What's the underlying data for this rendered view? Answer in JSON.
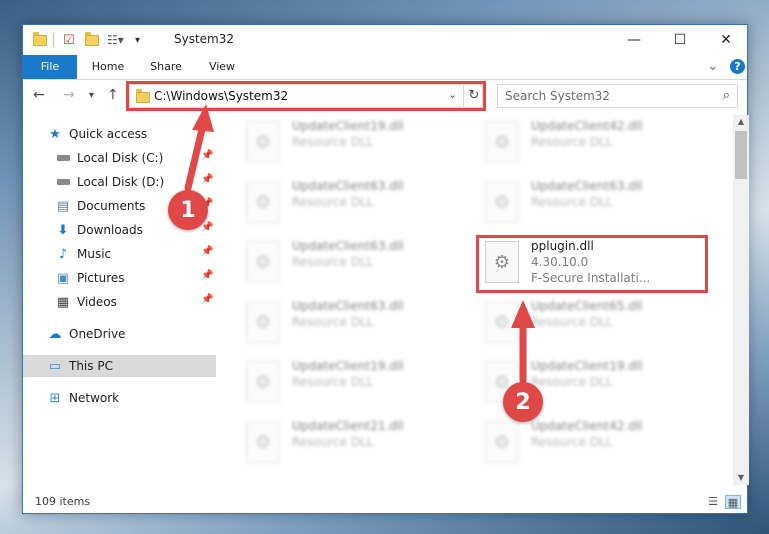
{
  "window": {
    "title": "System32",
    "controls": {
      "minimize": "—",
      "maximize": "☐",
      "close": "✕"
    }
  },
  "ribbon": {
    "tabs": [
      {
        "label": "File"
      },
      {
        "label": "Home"
      },
      {
        "label": "Share"
      },
      {
        "label": "View"
      }
    ],
    "collapse_glyph": "⌄",
    "help_glyph": "?"
  },
  "navbar": {
    "address": "C:\\Windows\\System32",
    "search_placeholder": "Search System32"
  },
  "sidebar": {
    "items": [
      {
        "label": "Quick access",
        "icon": "star-icon",
        "pinned": false,
        "selected": false
      },
      {
        "label": "Local Disk (C:)",
        "icon": "drive-icon",
        "pinned": true,
        "selected": false
      },
      {
        "label": "Local Disk (D:)",
        "icon": "drive-icon",
        "pinned": true,
        "selected": false
      },
      {
        "label": "Documents",
        "icon": "documents-icon",
        "pinned": true,
        "selected": false
      },
      {
        "label": "Downloads",
        "icon": "download-icon",
        "pinned": true,
        "selected": false
      },
      {
        "label": "Music",
        "icon": "music-icon",
        "pinned": true,
        "selected": false
      },
      {
        "label": "Pictures",
        "icon": "pictures-icon",
        "pinned": true,
        "selected": false
      },
      {
        "label": "Videos",
        "icon": "videos-icon",
        "pinned": true,
        "selected": false
      },
      {
        "label": "OneDrive",
        "icon": "cloud-icon",
        "pinned": false,
        "selected": false
      },
      {
        "label": "This PC",
        "icon": "computer-icon",
        "pinned": false,
        "selected": true
      },
      {
        "label": "Network",
        "icon": "network-icon",
        "pinned": false,
        "selected": false
      }
    ]
  },
  "files": {
    "left_column": [
      {
        "name": "UpdateClient19.dll",
        "type": "Resource DLL"
      },
      {
        "name": "UpdateClient63.dll",
        "type": "Resource DLL"
      },
      {
        "name": "UpdateClient63.dll",
        "type": "Resource DLL"
      },
      {
        "name": "UpdateClient63.dll",
        "type": "Resource DLL"
      },
      {
        "name": "UpdateClient19.dll",
        "type": "Resource DLL"
      },
      {
        "name": "UpdateClient21.dll",
        "type": "Resource DLL"
      }
    ],
    "right_column": [
      {
        "name": "UpdateClient42.dll",
        "type": "Resource DLL"
      },
      {
        "name": "UpdateClient63.dll",
        "type": "Resource DLL"
      },
      {
        "name": "pplugin.dll",
        "version": "4.30.10.0",
        "company": "F-Secure Installati...",
        "highlighted": true
      },
      {
        "name": "UpdateClient65.dll",
        "type": "Resource DLL"
      },
      {
        "name": "UpdateClient19.dll",
        "type": "Resource DLL"
      },
      {
        "name": "UpdateClient42.dll",
        "type": "Resource DLL"
      }
    ]
  },
  "status": {
    "item_count": "109 items"
  },
  "annotations": [
    {
      "number": "1"
    },
    {
      "number": "2"
    }
  ],
  "colors": {
    "accent": "#1979ca",
    "annotation_red": "#e04848",
    "selection_gray": "#d9d9d9"
  }
}
